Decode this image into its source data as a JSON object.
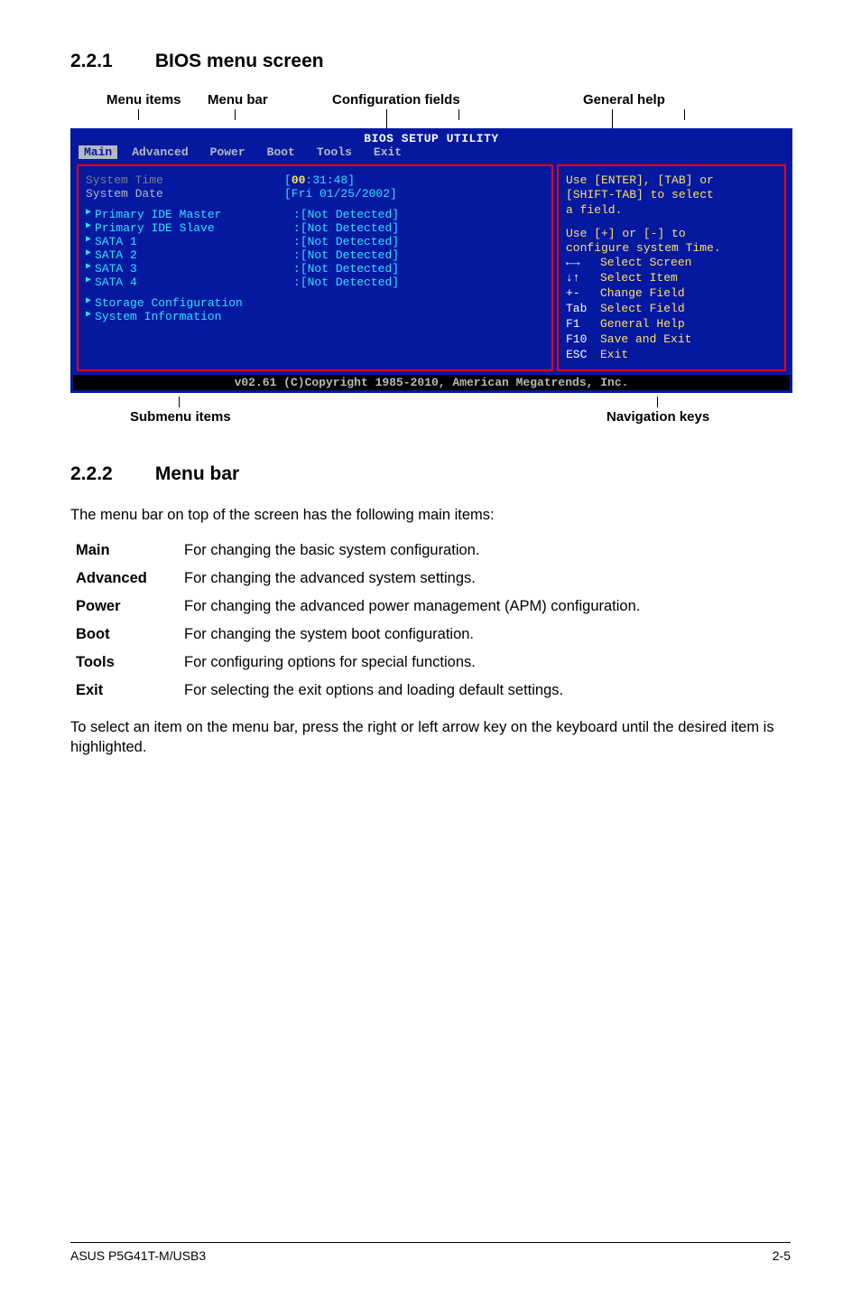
{
  "section1": {
    "num": "2.2.1",
    "title": "BIOS menu screen"
  },
  "callouts": {
    "menu_items": "Menu items",
    "menu_bar": "Menu bar",
    "config_fields": "Configuration fields",
    "general_help": "General help",
    "submenu": "Submenu items",
    "nav_keys": "Navigation keys"
  },
  "bios": {
    "title": "BIOS SETUP UTILITY",
    "tabs": [
      "Main",
      "Advanced",
      "Power",
      "Boot",
      "Tools",
      "Exit"
    ],
    "rows_sys": [
      {
        "label": "System Time",
        "value_pre": "[",
        "value_hh": "00",
        "value_rest": ":31:48]"
      },
      {
        "label": "System Date",
        "value": "[Fri 01/25/2002]"
      }
    ],
    "rows_dev": [
      {
        "label": "Primary IDE Master",
        "value": ":[Not Detected]"
      },
      {
        "label": "Primary IDE Slave",
        "value": ":[Not Detected]"
      },
      {
        "label": "SATA 1",
        "value": ":[Not Detected]"
      },
      {
        "label": "SATA 2",
        "value": ":[Not Detected]"
      },
      {
        "label": "SATA 3",
        "value": ":[Not Detected]"
      },
      {
        "label": "SATA 4",
        "value": ":[Not Detected]"
      }
    ],
    "rows_bottom": [
      "Storage Configuration",
      "System Information"
    ],
    "help_top": [
      "Use [ENTER], [TAB] or",
      "[SHIFT-TAB] to select",
      "a field.",
      "",
      "Use [+] or [-] to",
      "configure system Time."
    ],
    "nav": [
      {
        "key": "←→",
        "label": "Select Screen"
      },
      {
        "key": "↓↑",
        "label": "Select Item"
      },
      {
        "key": "+-",
        "label": "Change Field"
      },
      {
        "key": "Tab",
        "label": "Select Field"
      },
      {
        "key": "F1",
        "label": "General Help"
      },
      {
        "key": "F10",
        "label": "Save and Exit"
      },
      {
        "key": "ESC",
        "label": "Exit"
      }
    ],
    "footer": "v02.61 (C)Copyright 1985-2010, American Megatrends, Inc."
  },
  "section2": {
    "num": "2.2.2",
    "title": "Menu bar"
  },
  "section2_intro": "The menu bar on top of the screen has the following main items:",
  "menu_desc": [
    {
      "k": "Main",
      "v": "For changing the basic system configuration."
    },
    {
      "k": "Advanced",
      "v": "For changing the advanced system settings."
    },
    {
      "k": "Power",
      "v": "For changing the advanced power management (APM) configuration."
    },
    {
      "k": "Boot",
      "v": "For changing the system boot configuration."
    },
    {
      "k": "Tools",
      "v": "For configuring options for special functions."
    },
    {
      "k": "Exit",
      "v": "For selecting the exit options and loading default settings."
    }
  ],
  "section2_outro": "To select an item on the menu bar, press the right or left arrow key on the keyboard until the desired item is highlighted.",
  "footer": {
    "left": "ASUS P5G41T-M/USB3",
    "right": "2-5"
  }
}
